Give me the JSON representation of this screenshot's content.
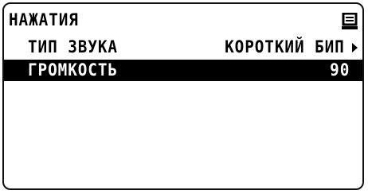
{
  "header": {
    "title": "НАЖАТИЯ",
    "icon": "message-icon"
  },
  "menu": {
    "items": [
      {
        "label": "ТИП ЗВУКА",
        "value": "КОРОТКИЙ БИП",
        "selected": false,
        "has_arrow": true
      },
      {
        "label": "ГРОМКОСТЬ",
        "value": "90",
        "selected": true,
        "has_arrow": false
      }
    ]
  },
  "colors": {
    "foreground": "#000000",
    "background": "#ffffff",
    "selection_bg": "#000000",
    "selection_fg": "#ffffff"
  }
}
